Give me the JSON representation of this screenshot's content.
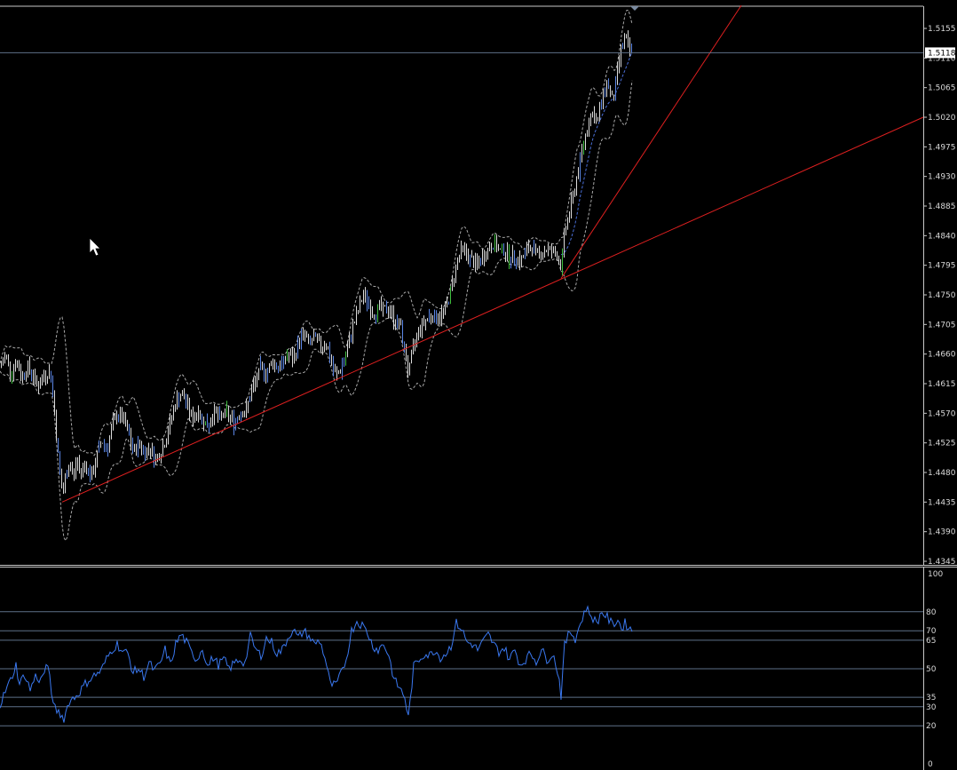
{
  "colors": {
    "background": "#000000",
    "frame": "#c8c8c8",
    "bar": "#dcdcdc",
    "bar_blue": "#5b86e6",
    "bar_green": "#3fbf3f",
    "bands": "#a8a8a8",
    "middle_band": "#4a6fd8",
    "trendline": "#e02020",
    "level_line": "#5e7088",
    "rsi_line": "#3a78f0",
    "price_tag_bg": "#ffffff"
  },
  "chart_data": [
    {
      "type": "candlestick",
      "title": "",
      "price_axis": {
        "ticks": [
          "1.5155",
          "1.5110",
          "1.5065",
          "1.5020",
          "1.4975",
          "1.4930",
          "1.4885",
          "1.4840",
          "1.4795",
          "1.4750",
          "1.4705",
          "1.4660",
          "1.4615",
          "1.4570",
          "1.4525",
          "1.4480",
          "1.4435",
          "1.4390",
          "1.4345"
        ],
        "range": [
          1.4345,
          1.5155
        ]
      },
      "current_price": "1.5118",
      "close_path": [
        [
          0,
          1.464
        ],
        [
          6,
          1.466
        ],
        [
          12,
          1.463
        ],
        [
          18,
          1.465
        ],
        [
          24,
          1.4625
        ],
        [
          30,
          1.464
        ],
        [
          36,
          1.463
        ],
        [
          42,
          1.461
        ],
        [
          48,
          1.4625
        ],
        [
          54,
          1.4635
        ],
        [
          58,
          1.462
        ],
        [
          62,
          1.4555
        ],
        [
          66,
          1.449
        ],
        [
          70,
          1.4445
        ],
        [
          74,
          1.4475
        ],
        [
          78,
          1.45
        ],
        [
          82,
          1.447
        ],
        [
          86,
          1.45
        ],
        [
          90,
          1.448
        ],
        [
          96,
          1.4495
        ],
        [
          102,
          1.447
        ],
        [
          108,
          1.45
        ],
        [
          114,
          1.453
        ],
        [
          120,
          1.4515
        ],
        [
          126,
          1.455
        ],
        [
          132,
          1.457
        ],
        [
          138,
          1.456
        ],
        [
          144,
          1.454
        ],
        [
          150,
          1.451
        ],
        [
          156,
          1.4525
        ],
        [
          162,
          1.451
        ],
        [
          168,
          1.452
        ],
        [
          174,
          1.45
        ],
        [
          180,
          1.451
        ],
        [
          186,
          1.453
        ],
        [
          192,
          1.456
        ],
        [
          198,
          1.459
        ],
        [
          204,
          1.46
        ],
        [
          210,
          1.4585
        ],
        [
          216,
          1.456
        ],
        [
          222,
          1.4575
        ],
        [
          228,
          1.456
        ],
        [
          234,
          1.455
        ],
        [
          240,
          1.4575
        ],
        [
          246,
          1.456
        ],
        [
          252,
          1.457
        ],
        [
          258,
          1.4565
        ],
        [
          264,
          1.4555
        ],
        [
          270,
          1.4575
        ],
        [
          276,
          1.457
        ],
        [
          282,
          1.46
        ],
        [
          288,
          1.462
        ],
        [
          294,
          1.464
        ],
        [
          300,
          1.463
        ],
        [
          306,
          1.465
        ],
        [
          312,
          1.464
        ],
        [
          318,
          1.4645
        ],
        [
          324,
          1.466
        ],
        [
          330,
          1.465
        ],
        [
          336,
          1.468
        ],
        [
          342,
          1.469
        ],
        [
          348,
          1.4675
        ],
        [
          354,
          1.4685
        ],
        [
          360,
          1.467
        ],
        [
          366,
          1.468
        ],
        [
          372,
          1.465
        ],
        [
          378,
          1.4625
        ],
        [
          384,
          1.464
        ],
        [
          390,
          1.466
        ],
        [
          396,
          1.47
        ],
        [
          402,
          1.472
        ],
        [
          408,
          1.475
        ],
        [
          414,
          1.474
        ],
        [
          420,
          1.472
        ],
        [
          426,
          1.473
        ],
        [
          432,
          1.4725
        ],
        [
          438,
          1.473
        ],
        [
          444,
          1.471
        ],
        [
          450,
          1.4705
        ],
        [
          456,
          1.466
        ],
        [
          460,
          1.463
        ],
        [
          466,
          1.4675
        ],
        [
          472,
          1.47
        ],
        [
          478,
          1.471
        ],
        [
          484,
          1.472
        ],
        [
          490,
          1.4715
        ],
        [
          496,
          1.472
        ],
        [
          502,
          1.473
        ],
        [
          508,
          1.476
        ],
        [
          514,
          1.48
        ],
        [
          520,
          1.482
        ],
        [
          526,
          1.481
        ],
        [
          532,
          1.48
        ],
        [
          538,
          1.4795
        ],
        [
          544,
          1.481
        ],
        [
          550,
          1.482
        ],
        [
          556,
          1.483
        ],
        [
          562,
          1.4815
        ],
        [
          568,
          1.482
        ],
        [
          574,
          1.4805
        ],
        [
          580,
          1.481
        ],
        [
          586,
          1.48
        ],
        [
          592,
          1.4815
        ],
        [
          598,
          1.4825
        ],
        [
          604,
          1.481
        ],
        [
          610,
          1.4815
        ],
        [
          616,
          1.482
        ],
        [
          622,
          1.4815
        ],
        [
          628,
          1.481
        ],
        [
          632,
          1.479
        ],
        [
          636,
          1.485
        ],
        [
          642,
          1.488
        ],
        [
          648,
          1.492
        ],
        [
          654,
          1.496
        ],
        [
          660,
          1.5
        ],
        [
          666,
          1.503
        ],
        [
          672,
          1.501
        ],
        [
          678,
          1.505
        ],
        [
          684,
          1.5075
        ],
        [
          690,
          1.504
        ],
        [
          696,
          1.51
        ],
        [
          700,
          1.513
        ],
        [
          704,
          1.514
        ],
        [
          708,
          1.512
        ],
        [
          712,
          1.5118
        ]
      ],
      "trendlines": [
        {
          "from": [
            70,
            1.4435
          ],
          "to": [
            1040,
            1.502
          ]
        },
        {
          "from": [
            632,
            1.4775
          ],
          "to": [
            835,
            1.519
          ]
        }
      ],
      "horizontal_line": 1.5118
    },
    {
      "type": "line",
      "title": "",
      "y_axis": {
        "range": [
          0,
          100
        ],
        "tick_labels": [
          "100",
          "0"
        ]
      },
      "levels": [
        "80",
        "70",
        "65",
        "50",
        "35",
        "30",
        "20"
      ],
      "values": [
        [
          0,
          31
        ],
        [
          6,
          38
        ],
        [
          12,
          44
        ],
        [
          18,
          52
        ],
        [
          22,
          42
        ],
        [
          28,
          47
        ],
        [
          34,
          39
        ],
        [
          40,
          46
        ],
        [
          46,
          44
        ],
        [
          52,
          51
        ],
        [
          56,
          47
        ],
        [
          60,
          30
        ],
        [
          66,
          27
        ],
        [
          72,
          24
        ],
        [
          78,
          33
        ],
        [
          84,
          35
        ],
        [
          90,
          38
        ],
        [
          96,
          42
        ],
        [
          102,
          45
        ],
        [
          108,
          47
        ],
        [
          114,
          49
        ],
        [
          120,
          55
        ],
        [
          126,
          60
        ],
        [
          132,
          63
        ],
        [
          138,
          59
        ],
        [
          144,
          58
        ],
        [
          150,
          48
        ],
        [
          156,
          50
        ],
        [
          162,
          46
        ],
        [
          168,
          53
        ],
        [
          174,
          49
        ],
        [
          180,
          52
        ],
        [
          186,
          60
        ],
        [
          192,
          52
        ],
        [
          198,
          63
        ],
        [
          204,
          68
        ],
        [
          210,
          64
        ],
        [
          216,
          58
        ],
        [
          222,
          55
        ],
        [
          228,
          61
        ],
        [
          234,
          51
        ],
        [
          240,
          56
        ],
        [
          246,
          52
        ],
        [
          252,
          55
        ],
        [
          258,
          50
        ],
        [
          264,
          53
        ],
        [
          270,
          55
        ],
        [
          276,
          53
        ],
        [
          282,
          67
        ],
        [
          288,
          60
        ],
        [
          294,
          57
        ],
        [
          300,
          66
        ],
        [
          306,
          64
        ],
        [
          312,
          58
        ],
        [
          318,
          60
        ],
        [
          324,
          66
        ],
        [
          330,
          71
        ],
        [
          336,
          66
        ],
        [
          342,
          70
        ],
        [
          348,
          67
        ],
        [
          354,
          63
        ],
        [
          360,
          65
        ],
        [
          366,
          56
        ],
        [
          372,
          42
        ],
        [
          378,
          41
        ],
        [
          384,
          47
        ],
        [
          390,
          55
        ],
        [
          396,
          70
        ],
        [
          402,
          75
        ],
        [
          408,
          73
        ],
        [
          414,
          69
        ],
        [
          420,
          62
        ],
        [
          426,
          60
        ],
        [
          432,
          63
        ],
        [
          438,
          57
        ],
        [
          444,
          44
        ],
        [
          450,
          40
        ],
        [
          456,
          35
        ],
        [
          460,
          24
        ],
        [
          466,
          51
        ],
        [
          472,
          55
        ],
        [
          478,
          58
        ],
        [
          484,
          57
        ],
        [
          490,
          60
        ],
        [
          496,
          56
        ],
        [
          502,
          58
        ],
        [
          508,
          62
        ],
        [
          514,
          74
        ],
        [
          520,
          71
        ],
        [
          526,
          64
        ],
        [
          532,
          63
        ],
        [
          538,
          60
        ],
        [
          544,
          64
        ],
        [
          550,
          68
        ],
        [
          556,
          63
        ],
        [
          562,
          59
        ],
        [
          568,
          61
        ],
        [
          574,
          55
        ],
        [
          580,
          60
        ],
        [
          586,
          52
        ],
        [
          592,
          55
        ],
        [
          598,
          58
        ],
        [
          604,
          54
        ],
        [
          610,
          60
        ],
        [
          616,
          55
        ],
        [
          622,
          58
        ],
        [
          626,
          53
        ],
        [
          630,
          44
        ],
        [
          632,
          36
        ],
        [
          636,
          62
        ],
        [
          642,
          70
        ],
        [
          648,
          66
        ],
        [
          654,
          74
        ],
        [
          660,
          82
        ],
        [
          666,
          78
        ],
        [
          672,
          74
        ],
        [
          678,
          80
        ],
        [
          684,
          77
        ],
        [
          690,
          73
        ],
        [
          696,
          76
        ],
        [
          700,
          71
        ],
        [
          704,
          74
        ],
        [
          708,
          72
        ],
        [
          712,
          70
        ]
      ]
    }
  ]
}
